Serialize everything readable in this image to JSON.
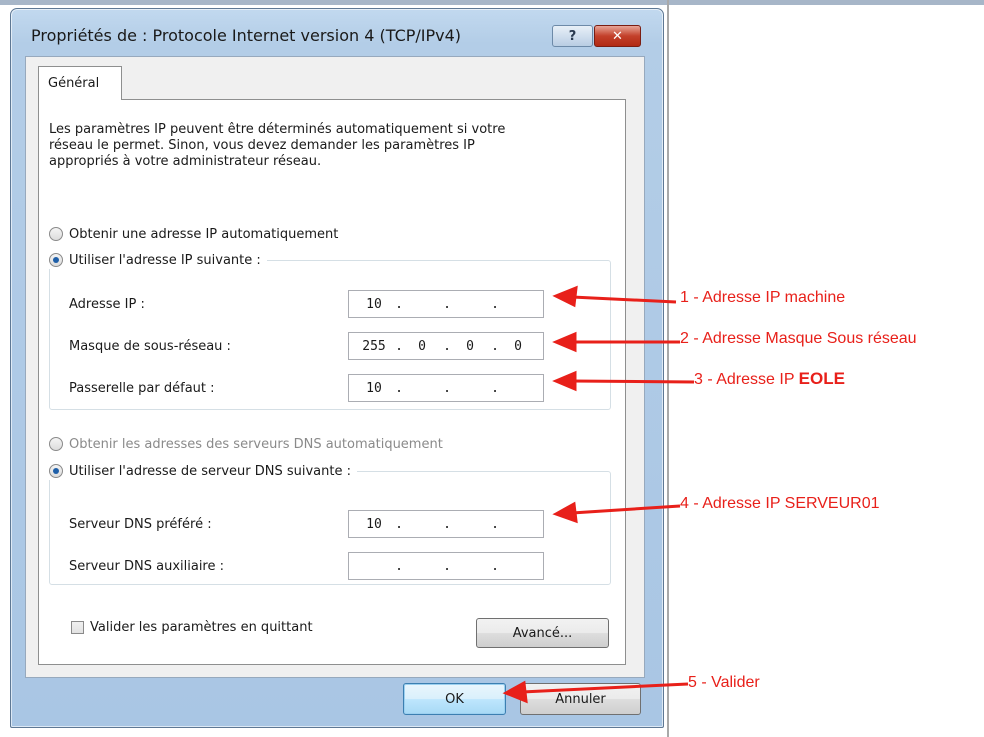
{
  "window": {
    "title": "Propriétés de : Protocole Internet version 4 (TCP/IPv4)",
    "help_label": "?",
    "close_label": "✕"
  },
  "tab": {
    "label": "Général"
  },
  "intro_lines": [
    "Les paramètres IP peuvent être déterminés automatiquement si votre",
    "réseau le permet. Sinon, vous devez demander les paramètres IP",
    "appropriés à votre administrateur réseau."
  ],
  "ip_section": {
    "auto_label": "Obtenir une adresse IP automatiquement",
    "manual_label": "Utiliser l'adresse IP suivante :",
    "selected": "manual",
    "fields": [
      {
        "label": "Adresse IP :",
        "octets": [
          "10",
          "",
          "",
          ""
        ]
      },
      {
        "label": "Masque de sous-réseau :",
        "octets": [
          "255",
          "0",
          "0",
          "0"
        ]
      },
      {
        "label": "Passerelle par défaut :",
        "octets": [
          "10",
          "",
          "",
          ""
        ]
      }
    ]
  },
  "dns_section": {
    "auto_label": "Obtenir les adresses des serveurs DNS automatiquement",
    "auto_disabled": true,
    "manual_label": "Utiliser l'adresse de serveur DNS suivante :",
    "selected": "manual",
    "fields": [
      {
        "label": "Serveur DNS préféré :",
        "octets": [
          "10",
          "",
          "",
          ""
        ]
      },
      {
        "label": "Serveur DNS auxiliaire :",
        "octets": [
          "",
          "",
          "",
          ""
        ]
      }
    ]
  },
  "validate_checkbox": {
    "label": "Valider les paramètres en quittant",
    "checked": false
  },
  "buttons": {
    "advanced": "Avancé...",
    "ok": "OK",
    "cancel": "Annuler"
  },
  "annotations": {
    "a1": "1 - Adresse IP machine",
    "a2": "2 - Adresse Masque Sous réseau",
    "a3_prefix": "3 - Adresse IP ",
    "a3_bold": "EOLE",
    "a4": "4 - Adresse IP SERVEUR01",
    "a5": "5 - Valider"
  },
  "colors": {
    "annotation": "#e8201a",
    "window_frame": "#b3cde7",
    "close_button": "#c3402a"
  }
}
